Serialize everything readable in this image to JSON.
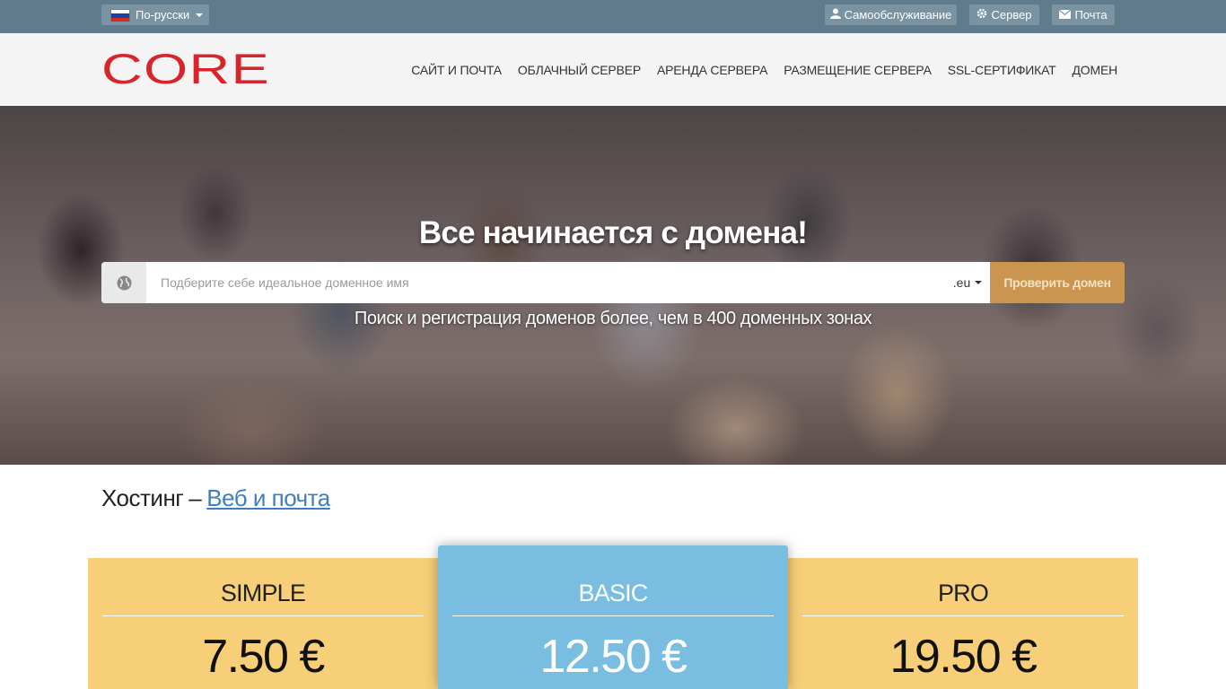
{
  "topbar": {
    "language": "По-русски",
    "links": [
      {
        "icon": "user-icon",
        "label": "Самообслуживание"
      },
      {
        "icon": "gear-icon",
        "label": "Сервер"
      },
      {
        "icon": "mail-icon",
        "label": "Почта"
      }
    ]
  },
  "header": {
    "logo_text": "CORE",
    "logo_color": "#d6262d",
    "nav": [
      "САЙТ И ПОЧТА",
      "ОБЛАЧНЫЙ СЕРВЕР",
      "АРЕНДА СЕРВЕРА",
      "РАЗМЕЩЕНИЕ СЕРВЕРА",
      "SSL-СЕРТИФИКАТ",
      "ДОМЕН"
    ]
  },
  "hero": {
    "title": "Все начинается с домена!",
    "search_placeholder": "Подберите себе идеальное доменное имя",
    "tld": ".eu",
    "check_button": "Проверить домен",
    "subtitle": "Поиск и регистрация доменов более, чем в 400 доменных зонах"
  },
  "section": {
    "title": "Хостинг",
    "dash": "–",
    "link": "Веб и почта"
  },
  "plans": [
    {
      "name": "SIMPLE",
      "price": "7.50 €",
      "color": "#f7cf78"
    },
    {
      "name": "BASIC",
      "price": "12.50 €",
      "color": "#79bde0"
    },
    {
      "name": "PRO",
      "price": "19.50 €",
      "color": "#f7cf78"
    }
  ],
  "colors": {
    "topbar": "#5f7b8c",
    "accent_button": "#c9954f",
    "link": "#3f7fbf"
  }
}
